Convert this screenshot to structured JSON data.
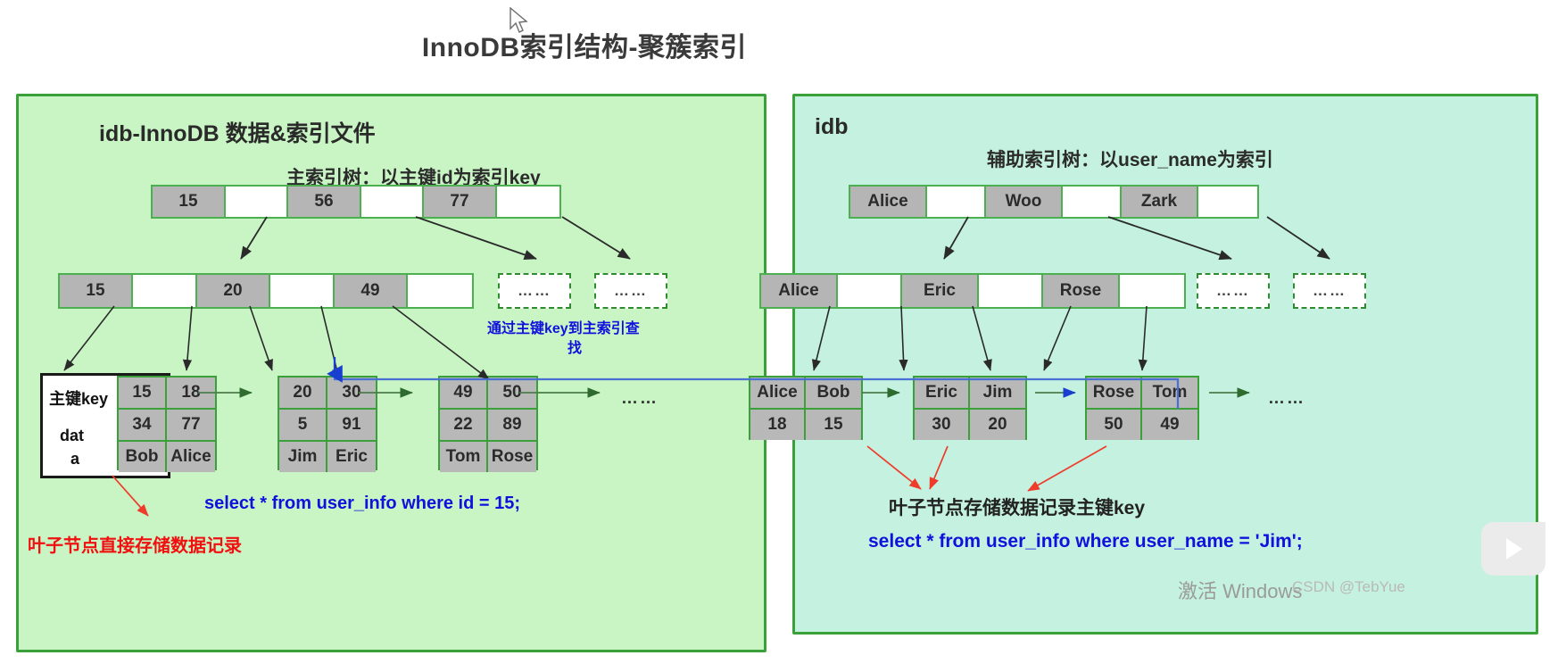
{
  "title": "InnoDB索引结构-聚簇索引",
  "left_panel": {
    "file_label": "idb-InnoDB 数据&索引文件",
    "tree_caption": "主索引树：以主键id为索引key",
    "root": {
      "cells": [
        {
          "type": "key",
          "text": "15"
        },
        {
          "type": "ptr",
          "text": ""
        },
        {
          "type": "key",
          "text": "56"
        },
        {
          "type": "ptr",
          "text": ""
        },
        {
          "type": "key",
          "text": "77"
        },
        {
          "type": "ptr",
          "text": ""
        }
      ]
    },
    "level2": {
      "cells": [
        {
          "type": "key",
          "text": "15"
        },
        {
          "type": "ptr",
          "text": ""
        },
        {
          "type": "key",
          "text": "20"
        },
        {
          "type": "ptr",
          "text": ""
        },
        {
          "type": "key",
          "text": "49"
        },
        {
          "type": "ptr",
          "text": ""
        }
      ]
    },
    "level2_dashed": [
      "……",
      "……"
    ],
    "leaves": [
      {
        "keys": [
          "15",
          "18"
        ],
        "data1": [
          "34",
          "77"
        ],
        "data2": [
          "Bob",
          "Alice"
        ]
      },
      {
        "keys": [
          "20",
          "30"
        ],
        "data1": [
          "5",
          "91"
        ],
        "data2": [
          "Jim",
          "Eric"
        ]
      },
      {
        "keys": [
          "49",
          "50"
        ],
        "data1": [
          "22",
          "89"
        ],
        "data2": [
          "Tom",
          "Rose"
        ]
      }
    ],
    "leaf_tail_ellipsis": "……",
    "bracket_label_key": "主键key",
    "bracket_label_data": "dat\na",
    "bracket_label_data_line1": "dat",
    "bracket_label_data_line2": "a",
    "annotation_blue_line1": "通过主键key到主索引查",
    "annotation_blue_line2": "找",
    "annotation_sql": "select  * from user_info  where id = 15;",
    "annotation_red": "叶子节点直接存储数据记录"
  },
  "right_panel": {
    "file_label": "idb",
    "tree_caption": "辅助索引树：以user_name为索引",
    "root": {
      "cells": [
        {
          "type": "key",
          "text": "Alice"
        },
        {
          "type": "ptr",
          "text": ""
        },
        {
          "type": "key",
          "text": "Woo"
        },
        {
          "type": "ptr",
          "text": ""
        },
        {
          "type": "key",
          "text": "Zark"
        },
        {
          "type": "ptr",
          "text": ""
        }
      ]
    },
    "level2": {
      "cells": [
        {
          "type": "key",
          "text": "Alice"
        },
        {
          "type": "ptr",
          "text": ""
        },
        {
          "type": "key",
          "text": "Eric"
        },
        {
          "type": "ptr",
          "text": ""
        },
        {
          "type": "key",
          "text": "Rose"
        },
        {
          "type": "ptr",
          "text": ""
        }
      ]
    },
    "level2_dashed": [
      "……",
      "……"
    ],
    "leaves": [
      {
        "keys": [
          "Alice",
          "Bob"
        ],
        "values": [
          "18",
          "15"
        ]
      },
      {
        "keys": [
          "Eric",
          "Jim"
        ],
        "values": [
          "30",
          "20"
        ]
      },
      {
        "keys": [
          "Rose",
          "Tom"
        ],
        "values": [
          "50",
          "49"
        ]
      }
    ],
    "leaf_tail_ellipsis": "……",
    "annotation_dark": "叶子节点存储数据记录主键key",
    "annotation_sql": "select  * from user_info  where user_name = 'Jim';"
  },
  "watermark": {
    "activate_windows": "激活 Windows",
    "credit": "CSDN @TebYue"
  },
  "colors": {
    "panel_left_bg": "#c9f5c4",
    "panel_right_bg": "#c5f2e0",
    "panel_border": "#3aa03a",
    "key_cell": "#b5b5b5",
    "blue_text": "#1111dd",
    "red_text": "#f01010",
    "blue_link": "#4a6fd4",
    "red_arrow": "#ef3b2c"
  }
}
